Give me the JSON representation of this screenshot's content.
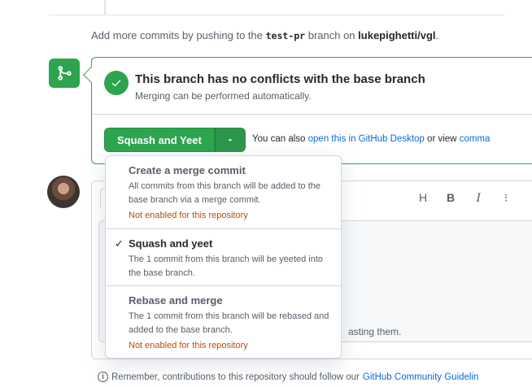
{
  "push_note": {
    "prefix": "Add more commits by pushing to the",
    "branch": "test-pr",
    "middle": "branch on",
    "repo": "lukepighetti/vgl",
    "suffix": "."
  },
  "merge_status": {
    "title": "This branch has no conflicts with the base branch",
    "subtitle": "Merging can be performed automatically."
  },
  "merge_button": {
    "label": "Squash and Yeet"
  },
  "also_text": {
    "prefix": "You can also",
    "desktop_link": "open this in GitHub Desktop",
    "middle": "or view",
    "cli_link": "comma"
  },
  "merge_options": [
    {
      "title": "Create a merge commit",
      "description": "All commits from this branch will be added to the base branch via a merge commit.",
      "warning": "Not enabled for this repository",
      "selected": false
    },
    {
      "title": "Squash and yeet",
      "description": "The 1 commit from this branch will be yeeted into the base branch.",
      "warning": "",
      "selected": true
    },
    {
      "title": "Rebase and merge",
      "description": "The 1 commit from this branch will be rebased and added to the base branch.",
      "warning": "Not enabled for this repository",
      "selected": false
    }
  ],
  "check_mark": "✓",
  "toolbar": {
    "heading": "H",
    "bold": "B",
    "italic": "I"
  },
  "comment": {
    "paste_hint": "asting them."
  },
  "footer": {
    "prefix": "Remember, contributions to this repository should follow our",
    "link": "GitHub Community Guidelin"
  },
  "colors": {
    "success": "#2da44e",
    "link": "#0969da",
    "warning": "#bc4c00"
  },
  "icons": {
    "merge_badge": "git-merge-icon",
    "status": "check-circle-icon",
    "caret": "triangle-down-icon",
    "footer": "info-icon"
  }
}
